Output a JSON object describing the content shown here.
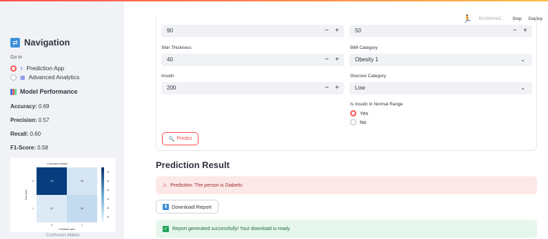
{
  "sidebar": {
    "title": "Navigation",
    "goto_label": "Go to",
    "options": [
      {
        "label": "Prediction App",
        "selected": true,
        "icon": "network-icon"
      },
      {
        "label": "Advanced Analytics",
        "selected": false,
        "icon": "chart-icon"
      }
    ],
    "model_performance_title": "Model Performance",
    "metrics": {
      "accuracy_label": "Accuracy:",
      "accuracy": "0.69",
      "precision_label": "Precision:",
      "precision": "0.57",
      "recall_label": "Recall:",
      "recall": "0.60",
      "f1_label": "F1-Score:",
      "f1": "0.58"
    },
    "cm_caption": "Confusion Matrix",
    "confusion_matrix": {
      "title": "Confusion Matrix",
      "xlabel": "Predicted label",
      "ylabel": "True label",
      "tick_labels": [
        "0",
        "1"
      ],
      "colorbar_ticks": [
        "70",
        "60",
        "50",
        "40",
        "30",
        "20"
      ],
      "values": [
        [
          "74",
          "25"
        ],
        [
          "22",
          "33"
        ]
      ],
      "cell_colors": [
        [
          "#083e7e",
          "#d5e5f4"
        ],
        [
          "#dceaf6",
          "#c4dbef"
        ]
      ]
    }
  },
  "toolbar": {
    "status": "RUNNING...",
    "stop": "Stop",
    "deploy": "Deploy"
  },
  "form": {
    "top_left_value": "90",
    "top_right_value": "50",
    "skin_label": "Skin Thickness",
    "skin_value": "40",
    "bmi_label": "BMI Category",
    "bmi_value": "Obesity 1",
    "insulin_label": "Insulin",
    "insulin_value": "200",
    "glucose_label": "Glucose Category",
    "glucose_value": "Low",
    "normal_label": "Is Insulin in Normal Range",
    "normal_yes": "Yes",
    "normal_no": "No",
    "minus": "−",
    "plus": "+",
    "predict_label": "Predict"
  },
  "result": {
    "title": "Prediction Result",
    "error_text": "Prediction: The person is Diabetic",
    "download_label": "Download Report",
    "success_text": "Report generated successfully! Your download is ready."
  },
  "colors": {
    "accent": "#ff4b4b",
    "sidebar_bg": "#f0f2f6",
    "error_bg": "#fde8e8",
    "success_bg": "#e6f6ec"
  }
}
